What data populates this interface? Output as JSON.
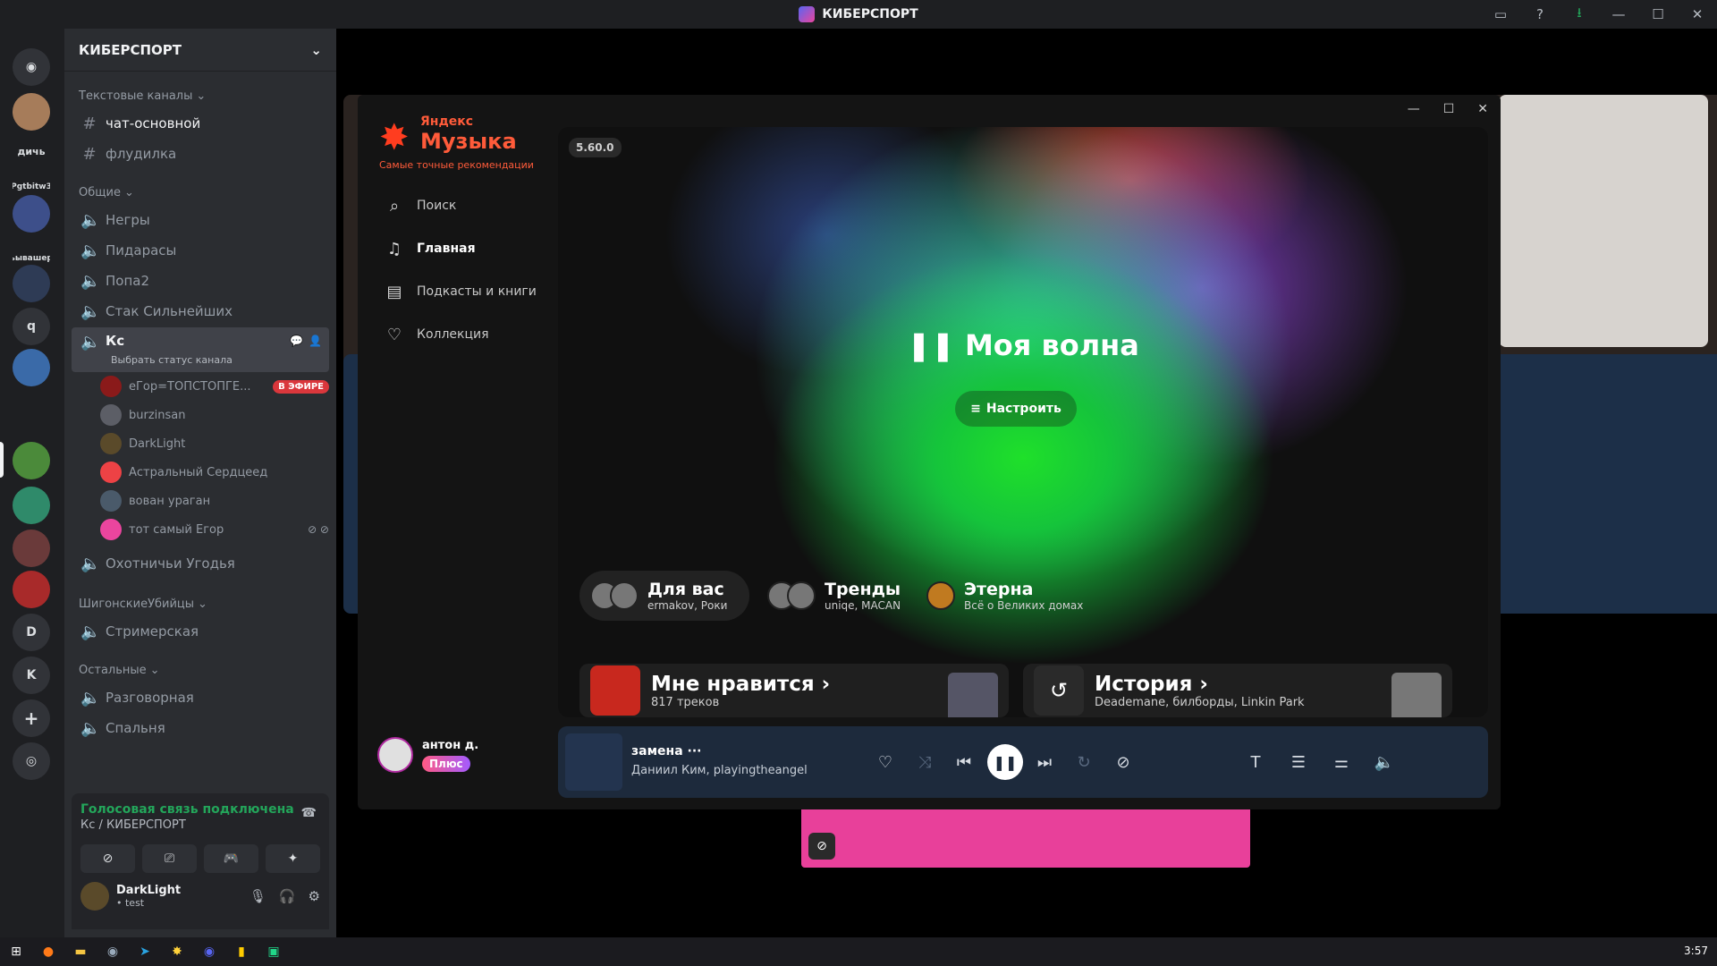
{
  "discord": {
    "window_title": "КИБЕРСПОРТ",
    "server_name": "КИБЕРСПОРТ",
    "servers": [
      "дичь",
      "Pgtbitw3",
      "ьывашер",
      "q",
      "D",
      "K"
    ],
    "categories": {
      "text": "Текстовые каналы",
      "general": "Общие",
      "shigon": "ШигонскиеУбийцы",
      "other": "Остальные"
    },
    "text_channels": [
      "чат-основной",
      "флудилка"
    ],
    "voice_general": [
      "Негры",
      "Пидарасы",
      "Попа2",
      "Стак Сильнейших"
    ],
    "selected_channel": {
      "name": "Кс",
      "status": "Выбрать статус канала"
    },
    "voice_users": [
      {
        "name": "еГор=ТОПСТОПГЕ...",
        "badge": "В ЭФИРЕ"
      },
      {
        "name": "burzinsan"
      },
      {
        "name": "DarkLight"
      },
      {
        "name": "Астральный Сердцеед"
      },
      {
        "name": "вован ураган"
      },
      {
        "name": "тот самый Егор"
      }
    ],
    "channel_hunting": "Охотничьи Угодья",
    "channel_stream": "Стримерская",
    "other_channels": [
      "Разговорная",
      "Спальня"
    ],
    "voice_panel": {
      "status": "Голосовая связь подключена",
      "location": "Кс / КИБЕРСПОРТ"
    },
    "me": {
      "name": "DarkLight",
      "status": "• test"
    }
  },
  "music": {
    "logo_top": "Яндекс",
    "logo_main": "Музыка",
    "tagline": "Самые точные рекомендации",
    "version": "5.60.0",
    "nav": [
      "Поиск",
      "Главная",
      "Подкасты и книги",
      "Коллекция"
    ],
    "wave_title": "Моя волна",
    "wave_button": "Настроить",
    "chips": [
      {
        "title": "Для вас",
        "sub": "ermakov, Роки"
      },
      {
        "title": "Тренды",
        "sub": "uniqe, MACAN"
      },
      {
        "title": "Этерна",
        "sub": "Всё о Великих домах"
      }
    ],
    "cards": [
      {
        "title": "Мне нравится",
        "sub": "817 треков"
      },
      {
        "title": "История",
        "sub": "Deademane, билборды, Linkin Park"
      }
    ],
    "user": {
      "name": "антон д.",
      "plus": "Плюс"
    },
    "player": {
      "track": "замена",
      "artists": "Даниил Ким, playingtheangel"
    }
  },
  "taskbar": {
    "clock": "3:57"
  }
}
